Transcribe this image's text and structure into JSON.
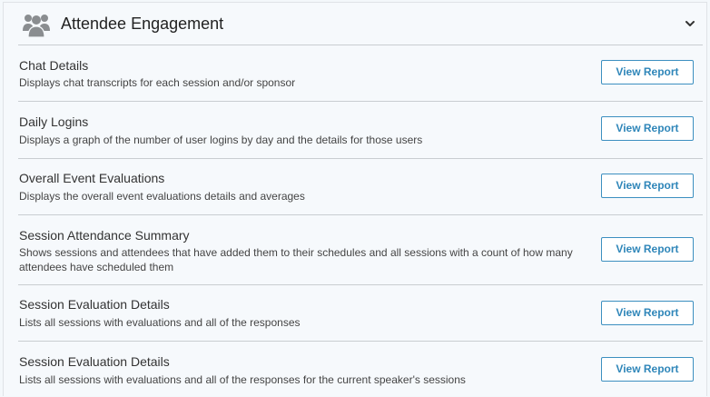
{
  "section": {
    "title": "Attendee Engagement",
    "icon": "users-group-icon",
    "toggle_icon": "chevron-down-icon"
  },
  "reports": [
    {
      "title": "Chat Details",
      "description": "Displays chat transcripts for each session and/or sponsor",
      "button_label": "View Report"
    },
    {
      "title": "Daily Logins",
      "description": "Displays a graph of the number of user logins by day and the details for those users",
      "button_label": "View Report"
    },
    {
      "title": "Overall Event Evaluations",
      "description": "Displays the overall event evaluations details and averages",
      "button_label": "View Report"
    },
    {
      "title": "Session Attendance Summary",
      "description": "Shows sessions and attendees that have added them to their schedules and all sessions with a count of how many attendees have scheduled them",
      "button_label": "View Report"
    },
    {
      "title": "Session Evaluation Details",
      "description": "Lists all sessions with evaluations and all of the responses",
      "button_label": "View Report"
    },
    {
      "title": "Session Evaluation Details",
      "description": "Lists all sessions with evaluations and all of the responses for the current speaker's sessions",
      "button_label": "View Report"
    }
  ],
  "colors": {
    "accent": "#2f86b9",
    "icon_gray": "#8a8d90"
  }
}
